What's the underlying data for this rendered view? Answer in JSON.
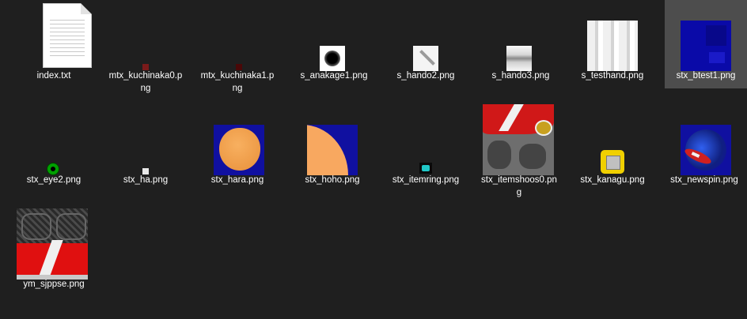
{
  "files": [
    {
      "name": "index.txt",
      "kind": "text-file-icon"
    },
    {
      "name": "mtx_kuchinaka0.png",
      "kind": "dark-red-square-thumbnail",
      "color": "#7a1a1a"
    },
    {
      "name": "mtx_kuchinaka1.png",
      "kind": "dark-red-square-thumbnail",
      "color": "#4a0808"
    },
    {
      "name": "s_anakage1.png",
      "kind": "black-dot-thumbnail"
    },
    {
      "name": "s_hando2.png",
      "kind": "diagonal-stroke-thumbnail"
    },
    {
      "name": "s_hando3.png",
      "kind": "silver-gradient-thumbnail"
    },
    {
      "name": "s_testhand.png",
      "kind": "white-glove-texture-thumbnail"
    },
    {
      "name": "stx_btest1.png",
      "kind": "blue-square-thumbnail",
      "color": "#0a0aa8",
      "selected": true
    },
    {
      "name": "stx_eye2.png",
      "kind": "green-eye-thumbnail",
      "color": "#00a000"
    },
    {
      "name": "stx_ha.png",
      "kind": "small-white-square-thumbnail"
    },
    {
      "name": "stx_hara.png",
      "kind": "orange-belly-on-blue-thumbnail",
      "color": "#f0a050"
    },
    {
      "name": "stx_hoho.png",
      "kind": "orange-cheek-on-blue-thumbnail",
      "color": "#f8a860"
    },
    {
      "name": "stx_itemring.png",
      "kind": "cyan-ring-thumbnail",
      "color": "#20c8c8"
    },
    {
      "name": "stx_itemshoos0.png",
      "kind": "red-shoe-texture-thumbnail",
      "color": "#d01818"
    },
    {
      "name": "stx_kanagu.png",
      "kind": "gold-buckle-thumbnail",
      "color": "#e8c800"
    },
    {
      "name": "stx_newspin.png",
      "kind": "blue-spin-thumbnail",
      "color": "#1030c0"
    },
    {
      "name": "ym_sjppse.png",
      "kind": "shoe-sole-texture-thumbnail",
      "color": "#e01010"
    }
  ]
}
